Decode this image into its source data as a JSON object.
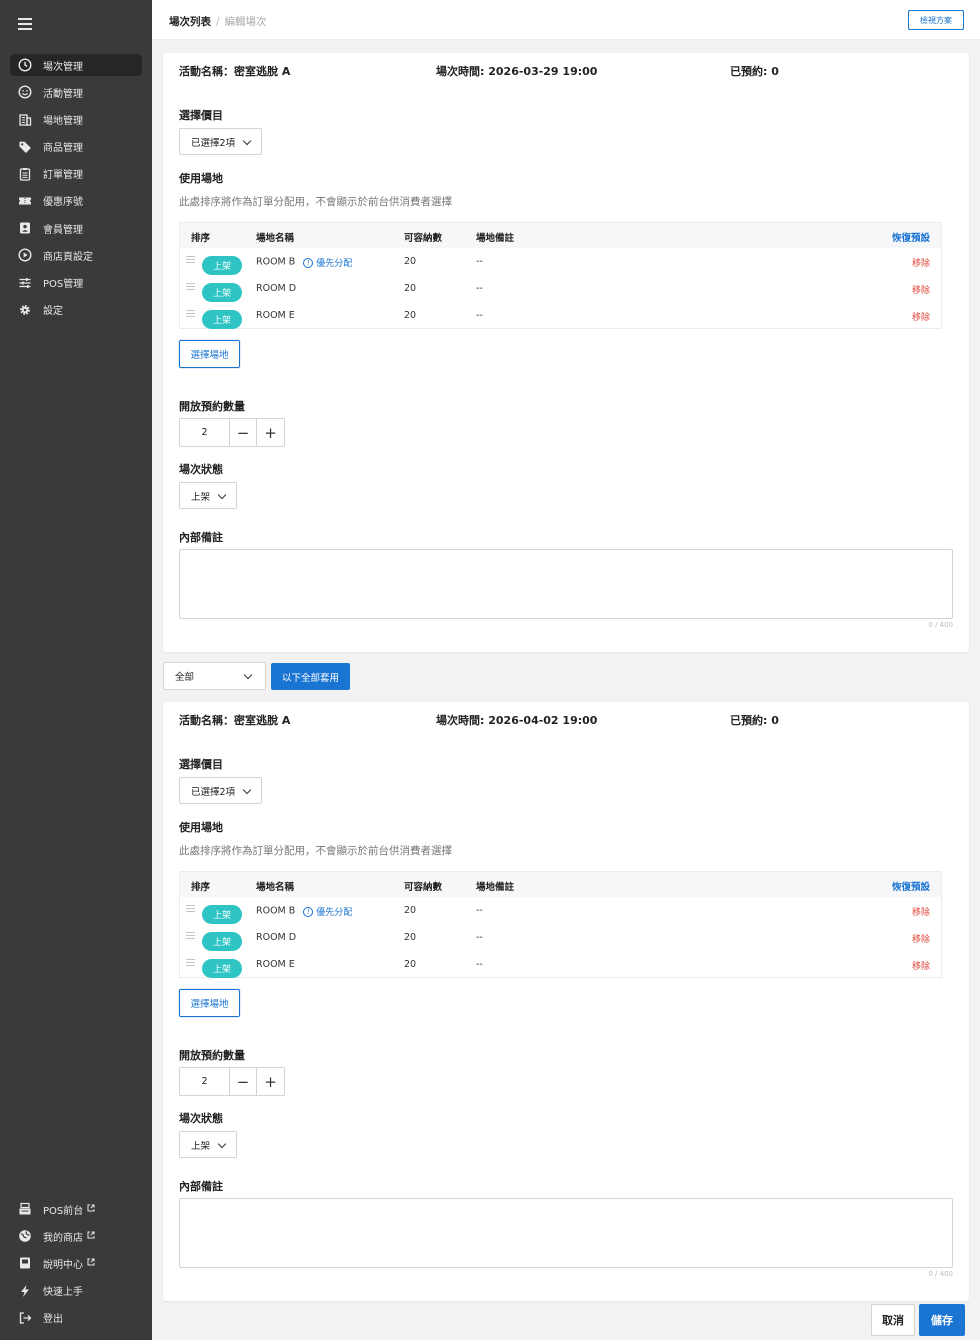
{
  "sidebar": {
    "items": [
      {
        "label": "場次管理",
        "icon": "clock-icon",
        "active": true
      },
      {
        "label": "活動管理",
        "icon": "smile-icon"
      },
      {
        "label": "場地管理",
        "icon": "building-icon"
      },
      {
        "label": "商品管理",
        "icon": "tag-icon"
      },
      {
        "label": "訂單管理",
        "icon": "clipboard-icon"
      },
      {
        "label": "優惠序號",
        "icon": "ticket-icon"
      },
      {
        "label": "會員管理",
        "icon": "member-icon"
      },
      {
        "label": "商店頁設定",
        "icon": "play-icon"
      },
      {
        "label": "POS管理",
        "icon": "sliders-icon"
      },
      {
        "label": "設定",
        "icon": "gear-icon"
      }
    ],
    "bottom": [
      {
        "label": "POS前台",
        "icon": "register-icon",
        "external": true
      },
      {
        "label": "我的商店",
        "icon": "globe-icon",
        "external": true
      },
      {
        "label": "說明中心",
        "icon": "book-icon",
        "external": true
      },
      {
        "label": "快速上手",
        "icon": "bolt-icon"
      },
      {
        "label": "登出",
        "icon": "logout-icon"
      }
    ]
  },
  "topbar": {
    "breadcrumb_current": "場次列表",
    "breadcrumb_sep": "/",
    "breadcrumb_sub": "編輯場次",
    "view_plan": "檢視方案"
  },
  "sessions": [
    {
      "event_name": "活動名稱：密室逃脫 A",
      "session_time": "場次時間: 2026-03-29 19:00",
      "booked": "已預約: 0",
      "price_label": "選擇價目",
      "price_value": "已選擇2項",
      "venue_label": "使用場地",
      "venue_hint": "此處排序將作為訂單分配用，不會顯示於前台供消費者選擇",
      "table": {
        "headers": [
          "排序",
          "場地名稱",
          "可容納數",
          "場地備註"
        ],
        "restore": "恢復預設",
        "rows": [
          {
            "status": "上架",
            "name": "ROOM B",
            "priority": "優先分配",
            "capacity": "20",
            "note": "--",
            "remove": "移除"
          },
          {
            "status": "上架",
            "name": "ROOM D",
            "priority": "",
            "capacity": "20",
            "note": "--",
            "remove": "移除"
          },
          {
            "status": "上架",
            "name": "ROOM E",
            "priority": "",
            "capacity": "20",
            "note": "--",
            "remove": "移除"
          }
        ]
      },
      "choose_venue": "選擇場地",
      "qty_label": "開放預約數量",
      "qty_value": "2",
      "status_label": "場次狀態",
      "status_value": "上架",
      "notes_label": "內部備註",
      "notes_counter": "0 / 400"
    },
    {
      "event_name": "活動名稱：密室逃脫 A",
      "session_time": "場次時間: 2026-04-02 19:00",
      "booked": "已預約: 0",
      "price_label": "選擇價目",
      "price_value": "已選擇2項",
      "venue_label": "使用場地",
      "venue_hint": "此處排序將作為訂單分配用，不會顯示於前台供消費者選擇",
      "table": {
        "headers": [
          "排序",
          "場地名稱",
          "可容納數",
          "場地備註"
        ],
        "restore": "恢復預設",
        "rows": [
          {
            "status": "上架",
            "name": "ROOM B",
            "priority": "優先分配",
            "capacity": "20",
            "note": "--",
            "remove": "移除"
          },
          {
            "status": "上架",
            "name": "ROOM D",
            "priority": "",
            "capacity": "20",
            "note": "--",
            "remove": "移除"
          },
          {
            "status": "上架",
            "name": "ROOM E",
            "priority": "",
            "capacity": "20",
            "note": "--",
            "remove": "移除"
          }
        ]
      },
      "choose_venue": "選擇場地",
      "qty_label": "開放預約數量",
      "qty_value": "2",
      "status_label": "場次狀態",
      "status_value": "上架",
      "notes_label": "內部備註",
      "notes_counter": "0 / 400"
    }
  ],
  "apply_bar": {
    "filter_value": "全部",
    "apply_label": "以下全部套用"
  },
  "footer": {
    "cancel": "取消",
    "save": "儲存"
  },
  "colors": {
    "primary": "#1a74d2",
    "pill": "#2ec4c4",
    "danger": "#e0453a",
    "sidebar_bg": "#3a3a3a"
  }
}
